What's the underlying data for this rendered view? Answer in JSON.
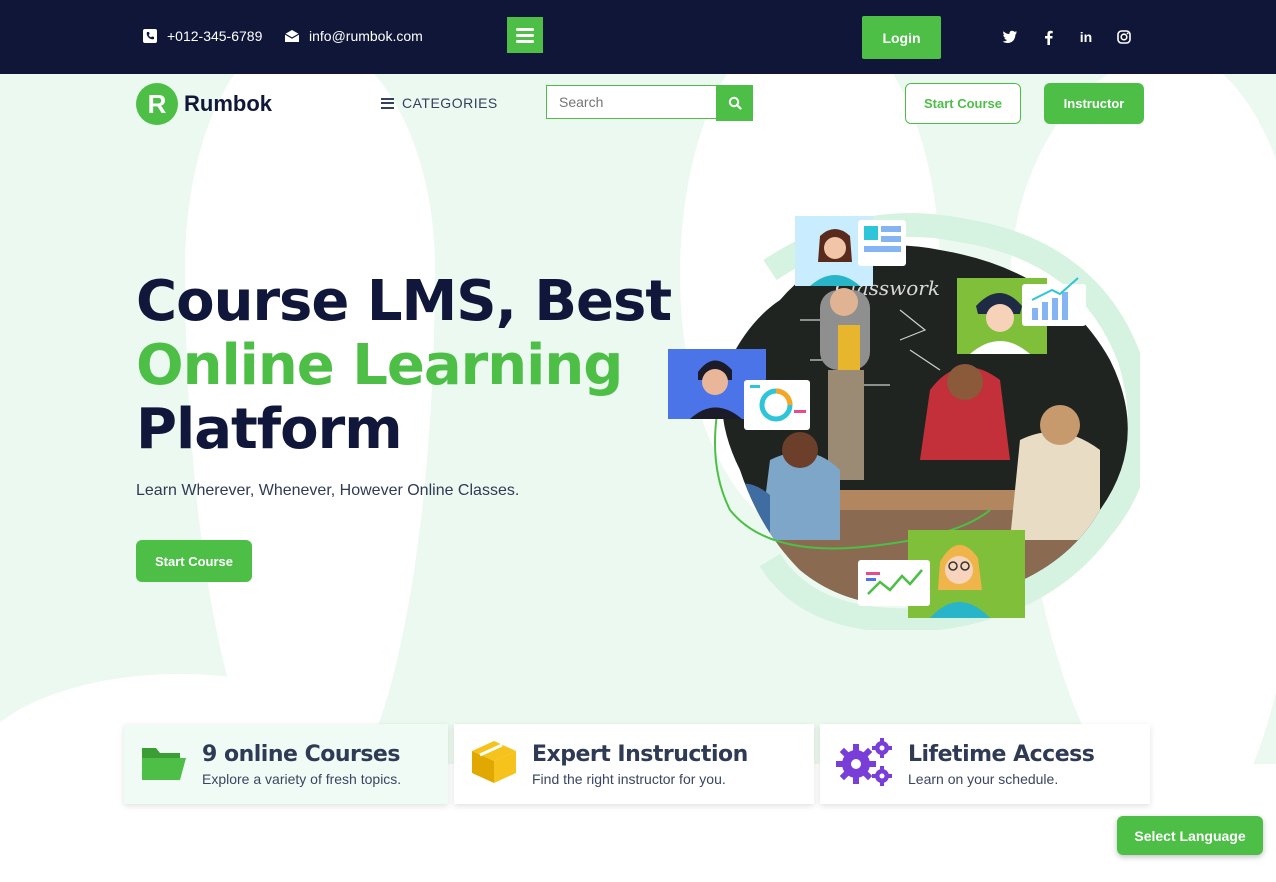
{
  "topbar": {
    "phone": "+012-345-6789",
    "email": "info@rumbok.com",
    "login_label": "Login",
    "social": [
      "twitter-icon",
      "facebook-icon",
      "linkedin-icon",
      "instagram-icon"
    ]
  },
  "header": {
    "logo_text": "Rumbok",
    "categories_label": "CATEGORIES",
    "search_placeholder": "Search",
    "start_course_label": "Start Course",
    "instructor_label": "Instructor"
  },
  "hero": {
    "title_line1": "Course LMS, Best",
    "title_line2": "Online Learning",
    "title_line3": "Platform",
    "subtitle": "Learn Wherever, Whenever, However Online Classes.",
    "cta_label": "Start Course",
    "board_text": "Classwork"
  },
  "features": [
    {
      "title": "9 online Courses",
      "desc": "Explore a variety of fresh topics.",
      "icon": "folder-icon"
    },
    {
      "title": "Expert Instruction",
      "desc": "Find the right instructor for you.",
      "icon": "box-icon"
    },
    {
      "title": "Lifetime Access",
      "desc": "Learn on your schedule.",
      "icon": "gears-icon"
    }
  ],
  "language_button": "Select Language",
  "colors": {
    "accent": "#4dbf47",
    "navy": "#0f1638",
    "hero_bg": "#ebf9f0"
  }
}
